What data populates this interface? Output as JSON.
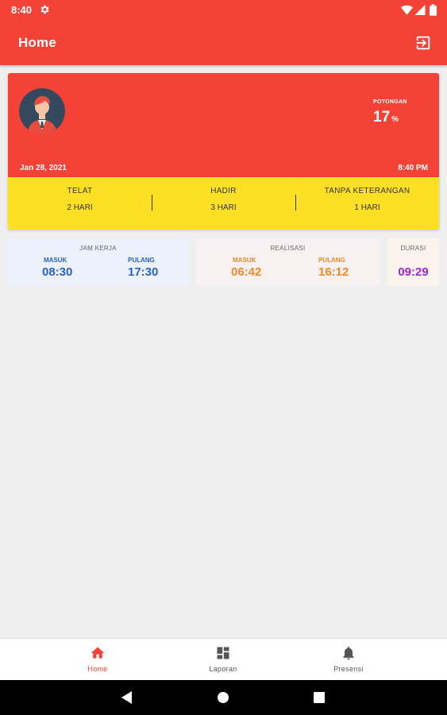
{
  "status_bar": {
    "time": "8:40"
  },
  "app_bar": {
    "title": "Home"
  },
  "summary": {
    "potongan_label": "POTONGAN",
    "potongan_value": "17",
    "potongan_unit": "%",
    "date": "Jan 28, 2021",
    "time": "8:40 PM",
    "stats": [
      {
        "label": "TELAT",
        "value": "2 HARI"
      },
      {
        "label": "HADIR",
        "value": "3 HARI"
      },
      {
        "label": "TANPA KETERANGAN",
        "value": "1 HARI"
      }
    ]
  },
  "jam_kerja": {
    "title": "JAM KERJA",
    "masuk_label": "MASUK",
    "masuk": "08:30",
    "pulang_label": "PULANG",
    "pulang": "17:30"
  },
  "realisasi": {
    "title": "REALISASI",
    "masuk_label": "MASUK",
    "masuk": "06:42",
    "pulang_label": "PULANG",
    "pulang": "16:12"
  },
  "durasi": {
    "title": "DURASI",
    "value": "09:29"
  },
  "bottom_nav": [
    {
      "label": "Home",
      "active": true
    },
    {
      "label": "Laporan",
      "active": false
    },
    {
      "label": "Presensi",
      "active": false
    }
  ],
  "colors": {
    "primary": "#f44336",
    "yellow": "#fddf23",
    "jam_kerja": "#2962c9",
    "realisasi": "#f0892b",
    "durasi": "#a424d6",
    "nav_inactive": "#555555"
  }
}
